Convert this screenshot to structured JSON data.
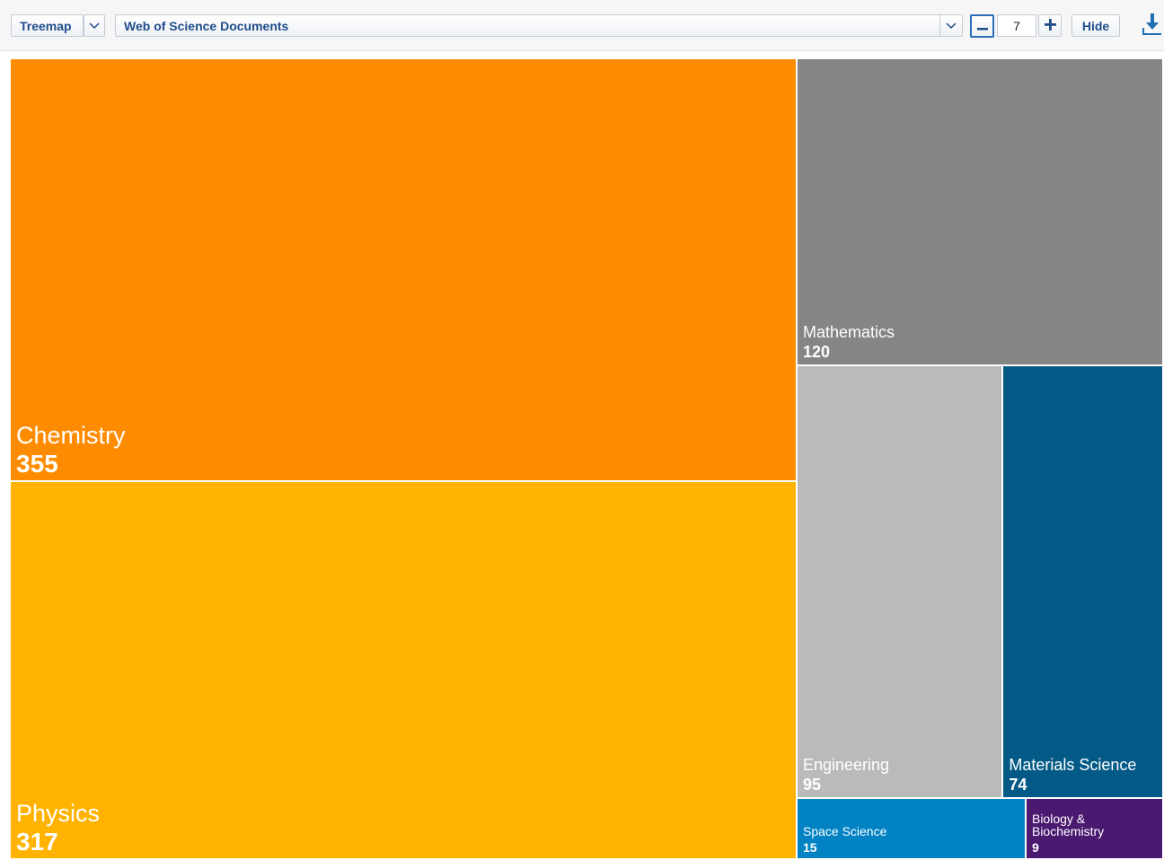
{
  "toolbar": {
    "viz_type": "Treemap",
    "metric": "Web of Science Documents",
    "count": "7",
    "hide_label": "Hide",
    "icons": {
      "viz_dropdown": "chevron-down-icon",
      "metric_dropdown": "chevron-down-icon",
      "decrease": "minus-icon",
      "increase": "plus-icon",
      "download": "download-icon"
    }
  },
  "chart_data": {
    "type": "treemap",
    "metric": "Web of Science Documents",
    "items": [
      {
        "label": "Chemistry",
        "value": 355,
        "color": "#FF8C00"
      },
      {
        "label": "Physics",
        "value": 317,
        "color": "#FFB300"
      },
      {
        "label": "Mathematics",
        "value": 120,
        "color": "#858585"
      },
      {
        "label": "Engineering",
        "value": 95,
        "color": "#BABABA"
      },
      {
        "label": "Materials Science",
        "value": 74,
        "color": "#045A87"
      },
      {
        "label": "Space Science",
        "value": 15,
        "color": "#0182C3"
      },
      {
        "label": "Biology &\nBiochemistry",
        "value": 9,
        "color": "#4A1970"
      }
    ]
  }
}
